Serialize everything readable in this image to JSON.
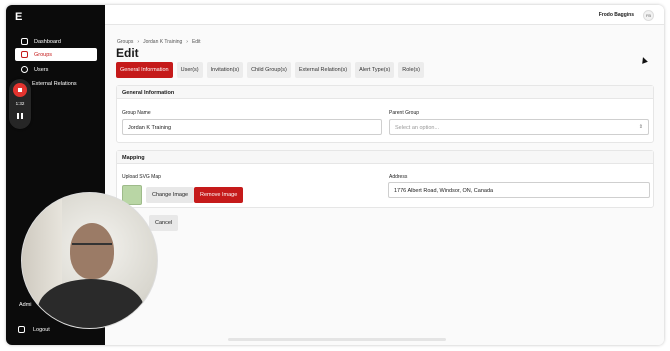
{
  "app": {
    "logo": "E"
  },
  "sidebar": {
    "items": [
      {
        "label": "Dashboard",
        "icon": "home-icon"
      },
      {
        "label": "Groups",
        "icon": "calendar-icon"
      },
      {
        "label": "Users",
        "icon": "users-icon"
      },
      {
        "label": "External Relations",
        "icon": "link-icon"
      }
    ],
    "admin_text": "Admi",
    "logout_label": "Logout"
  },
  "recorder": {
    "time": "1:32"
  },
  "header": {
    "user_name": "Frodo Baggins",
    "avatar_initials": "FB"
  },
  "breadcrumb": [
    "Groups",
    "Jordan K Training",
    "Edit"
  ],
  "page_title": "Edit",
  "tabs": [
    "General Information",
    "User(s)",
    "Invitation(s)",
    "Child Group(s)",
    "External Relation(s)",
    "Alert Type(s)",
    "Role(s)"
  ],
  "general_info": {
    "heading": "General Information",
    "group_name_label": "Group Name",
    "group_name_value": "Jordan K Training",
    "parent_group_label": "Parent Group",
    "parent_group_placeholder": "Select an option..."
  },
  "mapping": {
    "heading": "Mapping",
    "upload_label": "Upload SVG Map",
    "change_image_label": "Change Image",
    "remove_image_label": "Remove Image",
    "address_label": "Address",
    "address_value": "1776 Albert Road, Windsor, ON, Canada"
  },
  "actions": {
    "cancel_label": "Cancel"
  },
  "colors": {
    "accent": "#c51a1a",
    "sidebar_bg": "#0b0b0b"
  }
}
